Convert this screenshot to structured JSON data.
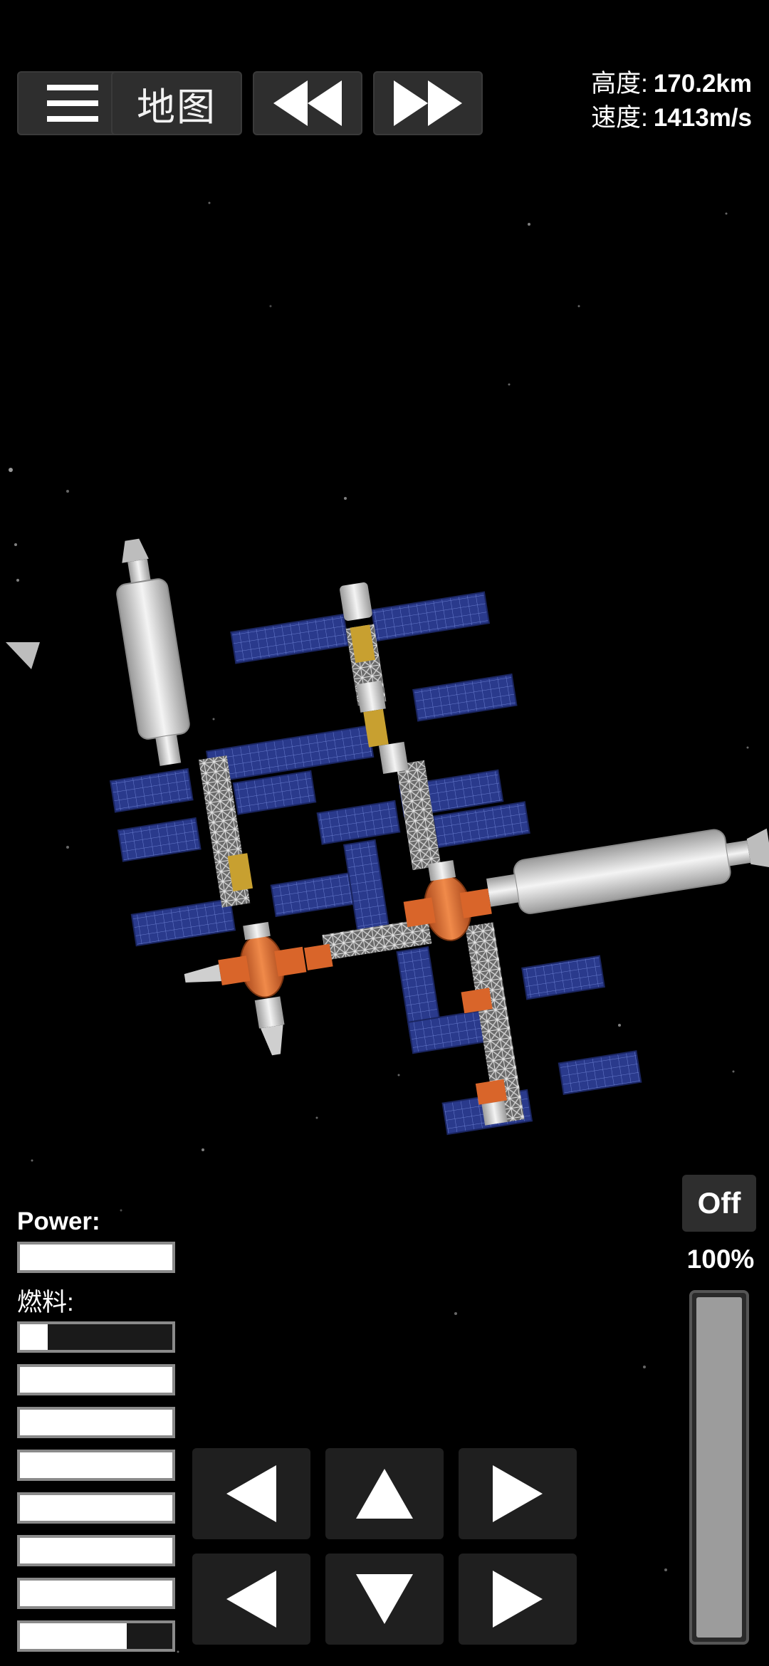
{
  "header": {
    "menu_icon": "hamburger-menu-icon",
    "map_label": "地图",
    "rewind_icon": "rewind-icon",
    "fastforward_icon": "fast-forward-icon"
  },
  "telemetry": {
    "altitude_label": "高度:",
    "altitude_value": "170.2km",
    "velocity_label": "速度:",
    "velocity_value": "1413m/s"
  },
  "gauges": {
    "power_label": "Power:",
    "power_level": 1.0,
    "fuel_label": "燃料:",
    "fuel_levels": [
      0.18,
      1.0,
      1.0,
      1.0,
      1.0,
      1.0,
      1.0,
      0.7
    ]
  },
  "controls": {
    "rotate_left_icon": "rotate-left-icon",
    "thrust_up_icon": "thrust-up-icon",
    "rotate_right_icon": "rotate-right-icon",
    "translate_left_icon": "translate-left-icon",
    "thrust_down_icon": "thrust-down-icon",
    "translate_right_icon": "translate-right-icon"
  },
  "throttle": {
    "toggle_label": "Off",
    "percent_label": "100%",
    "level": 1.0
  },
  "colors": {
    "background": "#000000",
    "solar_panel": "#2a3a8c",
    "module_orange": "#d9652a",
    "module_white": "#e6e6e6",
    "button_bg": "#2e2e2e"
  }
}
